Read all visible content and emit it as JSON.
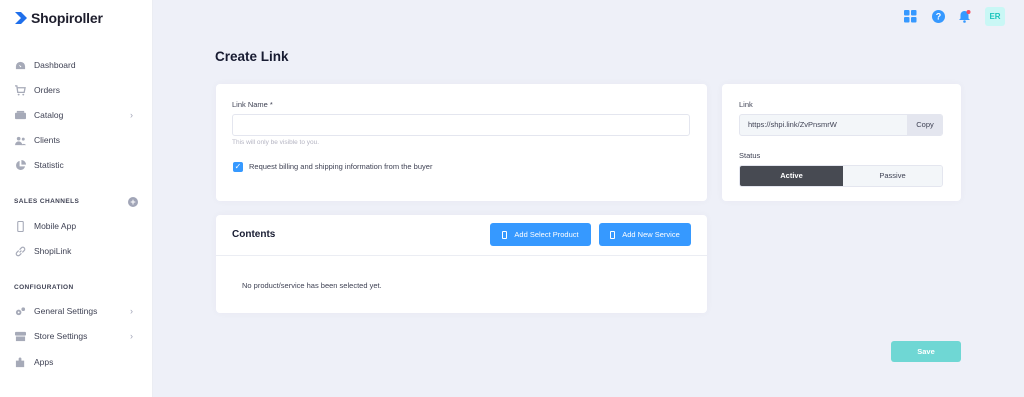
{
  "app": {
    "name": "Shopiroller"
  },
  "sidebar": {
    "items": [
      {
        "label": "Dashboard",
        "icon": "dashboard-icon"
      },
      {
        "label": "Orders",
        "icon": "cart-icon"
      },
      {
        "label": "Catalog",
        "icon": "catalog-icon",
        "has_children": true
      },
      {
        "label": "Clients",
        "icon": "clients-icon"
      },
      {
        "label": "Statistic",
        "icon": "pie-chart-icon"
      }
    ],
    "sales_channels": {
      "title": "SALES CHANNELS",
      "add_icon": "plus-circle-icon",
      "items": [
        {
          "label": "Mobile App",
          "icon": "mobile-icon"
        },
        {
          "label": "ShopiLink",
          "icon": "link-icon"
        }
      ]
    },
    "configuration": {
      "title": "CONFIGURATION",
      "items": [
        {
          "label": "General Settings",
          "icon": "gears-icon",
          "has_children": true
        },
        {
          "label": "Store Settings",
          "icon": "store-icon",
          "has_children": true
        },
        {
          "label": "Apps",
          "icon": "puzzle-icon"
        }
      ]
    }
  },
  "topbar": {
    "icons": [
      "apps-grid-icon",
      "help-icon",
      "notification-bell-icon"
    ],
    "avatar_initials": "ER"
  },
  "page": {
    "title": "Create Link"
  },
  "form": {
    "link_name_label": "Link Name *",
    "link_name_value": "",
    "link_name_placeholder": "",
    "hint": "This will only be visible to you.",
    "billing_checkbox_label": "Request billing and shipping information from the buyer",
    "billing_checked": true
  },
  "link_panel": {
    "link_label": "Link",
    "link_value": "https://shpi.link/ZvPnsmrW",
    "copy_label": "Copy",
    "status_label": "Status",
    "status_options": [
      "Active",
      "Passive"
    ],
    "status_selected": "Active"
  },
  "contents": {
    "title": "Contents",
    "add_product_label": "Add Select Product",
    "add_service_label": "Add New Service",
    "empty_message": "No product/service has been selected yet."
  },
  "actions": {
    "save_label": "Save"
  },
  "colors": {
    "primary": "#3699ff",
    "save": "#6fd7d4",
    "active_toggle": "#474a52",
    "background": "#eef0f8",
    "brand_blue": "#1f6feb"
  }
}
